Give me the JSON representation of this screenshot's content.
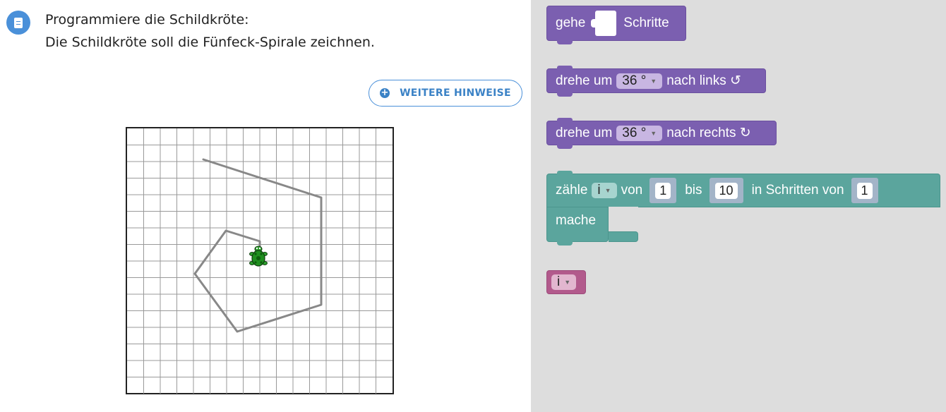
{
  "task": {
    "line1": "Programmiere die Schildkröte:",
    "line2": "Die Schildkröte soll die Fünfeck-Spirale zeichnen."
  },
  "hints_button": {
    "label": "WEITERE HINWEISE",
    "icon": "plus-circle-icon"
  },
  "canvas": {
    "grid_cells": 16,
    "turtle_icon": "turtle-icon",
    "path_color": "#888888"
  },
  "blocks": {
    "move": {
      "prefix": "gehe",
      "suffix": "Schritte"
    },
    "turn_left": {
      "prefix": "drehe um",
      "value": "36 °",
      "suffix": "nach links ↺"
    },
    "turn_right": {
      "prefix": "drehe um",
      "value": "36 °",
      "suffix": "nach rechts ↻"
    },
    "count": {
      "prefix": "zähle",
      "var": "i",
      "from_label": "von",
      "from": "1",
      "to_label": "bis",
      "to": "10",
      "step_label": "in Schritten von",
      "step": "1",
      "do_label": "mache"
    },
    "variable": {
      "var": "i"
    }
  },
  "colors": {
    "accent": "#4a90d9",
    "block_purple": "#7b5fb0",
    "block_teal": "#5ba59d",
    "block_pink": "#b25a8c",
    "workspace_bg": "#dddddd"
  }
}
